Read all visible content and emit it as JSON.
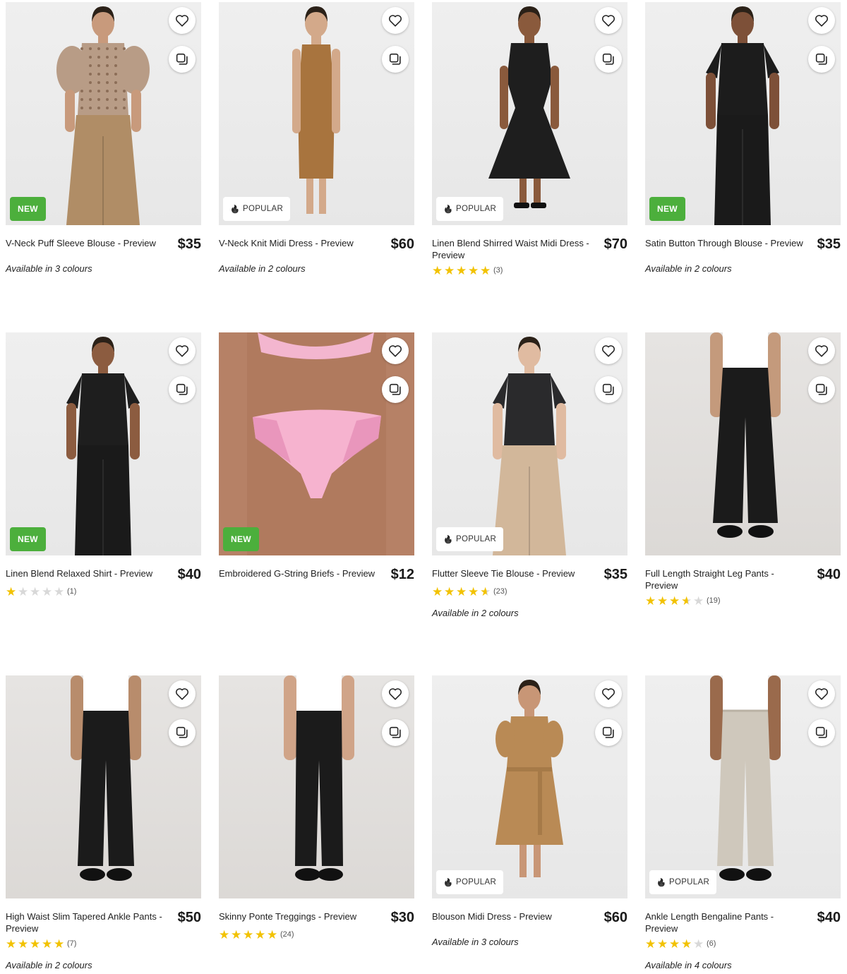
{
  "products": [
    {
      "title": "V-Neck Puff Sleeve Blouse - Preview",
      "price": "$35",
      "badge": "NEW",
      "colours": "Available in 3 colours",
      "rating": null,
      "count": "",
      "image": "model-blouse-print",
      "bg": "light"
    },
    {
      "title": "V-Neck Knit Midi Dress - Preview",
      "price": "$60",
      "badge": "POPULAR",
      "colours": "Available in 2 colours",
      "rating": null,
      "count": "",
      "image": "model-tan-knit-dress",
      "bg": "light"
    },
    {
      "title": "Linen Blend Shirred Waist Midi Dress - Preview",
      "price": "$70",
      "badge": "POPULAR",
      "colours": "",
      "rating": 5,
      "count": "(3)",
      "image": "model-black-midi-dress",
      "bg": "light"
    },
    {
      "title": "Satin Button Through Blouse - Preview",
      "price": "$35",
      "badge": "NEW",
      "colours": "Available in 2 colours",
      "rating": null,
      "count": "",
      "image": "model-black-satin-blouse",
      "bg": "light"
    },
    {
      "title": "Linen Blend Relaxed Shirt - Preview",
      "price": "$40",
      "badge": "NEW",
      "colours": "",
      "rating": 1,
      "count": "(1)",
      "image": "model-black-shirt",
      "bg": "light"
    },
    {
      "title": "Embroidered G-String Briefs - Preview",
      "price": "$12",
      "badge": "NEW",
      "colours": "",
      "rating": null,
      "count": "",
      "image": "pink-briefs",
      "bg": "skin"
    },
    {
      "title": "Flutter Sleeve Tie Blouse - Preview",
      "price": "$35",
      "badge": "POPULAR",
      "colours": "Available in 2 colours",
      "rating": 4.5,
      "count": "(23)",
      "image": "model-flutter-blouse",
      "bg": "light"
    },
    {
      "title": "Full Length Straight Leg Pants - Preview",
      "price": "$40",
      "badge": "",
      "colours": "",
      "rating": 3.5,
      "count": "(19)",
      "image": "black-straight-pants",
      "bg": "warm"
    },
    {
      "title": "High Waist Slim Tapered Ankle Pants - Preview",
      "price": "$50",
      "badge": "",
      "colours": "Available in 2 colours",
      "rating": 5,
      "count": "(7)",
      "image": "black-tapered-pants",
      "bg": "warm"
    },
    {
      "title": "Skinny Ponte Treggings - Preview",
      "price": "$30",
      "badge": "",
      "colours": "",
      "rating": 5,
      "count": "(24)",
      "image": "black-treggings",
      "bg": "warm"
    },
    {
      "title": "Blouson Midi Dress - Preview",
      "price": "$60",
      "badge": "POPULAR",
      "colours": "Available in 3 colours",
      "rating": null,
      "count": "",
      "image": "model-tan-midi-dress",
      "bg": "light"
    },
    {
      "title": "Ankle Length Bengaline Pants - Preview",
      "price": "$40",
      "badge": "POPULAR",
      "colours": "Available in 4 colours",
      "rating": 4,
      "count": "(6)",
      "image": "grey-bengaline-pants",
      "bg": "light"
    }
  ],
  "icons": {
    "wishlist": "heart-icon",
    "compare": "compare-icon",
    "popular": "flame-icon",
    "rating": "star-icon"
  },
  "colors": {
    "new_badge": "#4caf3c",
    "star": "#f2c200",
    "star_empty": "#d8d8d8"
  }
}
